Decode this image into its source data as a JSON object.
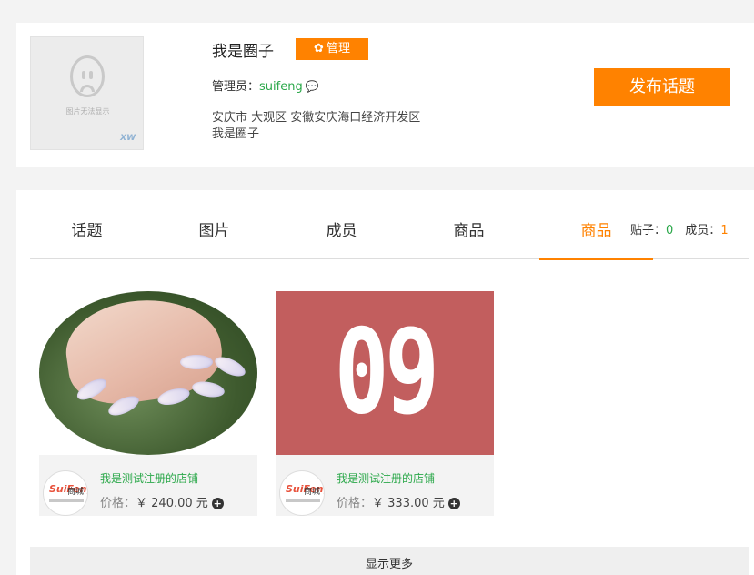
{
  "circle": {
    "avatar_placeholder_text": "图片无法显示",
    "avatar_watermark": "XW",
    "title": "我是圈子",
    "manage_label": "管理",
    "admin_label": "管理员：",
    "admin_name": "suifeng",
    "address": "安庆市 大观区 安徽安庆海口经济开发区",
    "description": "我是圈子",
    "post_button": "发布话题"
  },
  "tabs": [
    {
      "label": "话题",
      "active": false
    },
    {
      "label": "图片",
      "active": false
    },
    {
      "label": "成员",
      "active": false
    },
    {
      "label": "商品",
      "active": false
    },
    {
      "label": "商品",
      "active": true
    }
  ],
  "stats": {
    "posts_label": "贴子：",
    "posts_value": "0",
    "members_label": "成员：",
    "members_value": "1"
  },
  "products": [
    {
      "image": "nails-photo",
      "shop_logo_text": "SuiFeng",
      "shop_logo_sub": "商城",
      "shop_name": "我是测试注册的店铺",
      "price_label": "价格：",
      "price": "￥ 240.00 元"
    },
    {
      "image": "09",
      "shop_logo_text": "SuiFeng",
      "shop_logo_sub": "商城",
      "shop_name": "我是测试注册的店铺",
      "price_label": "价格：",
      "price": "￥ 333.00 元"
    }
  ],
  "show_more": "显示更多",
  "colors": {
    "accent": "#ff8200",
    "green": "#2ba84a",
    "page_bg": "#f3f3f3"
  }
}
